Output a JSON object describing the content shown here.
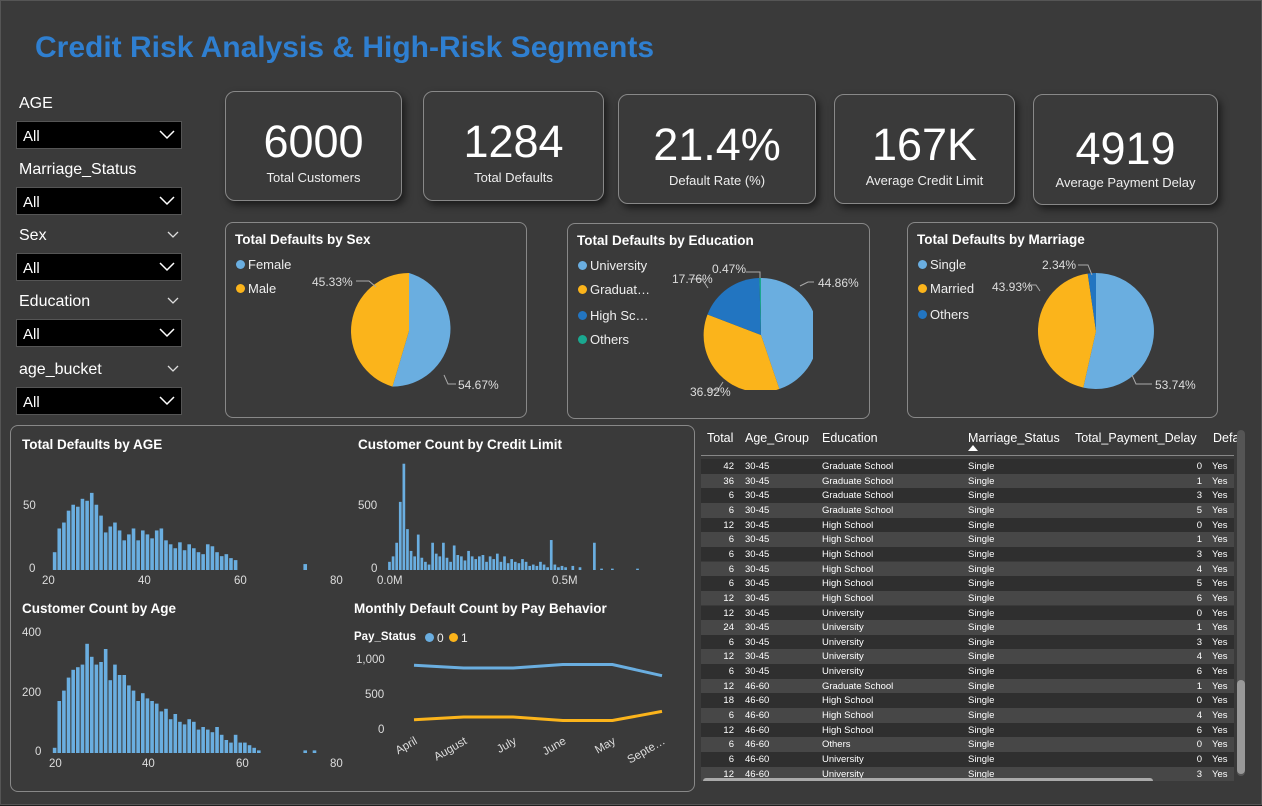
{
  "title": "Credit Risk Analysis & High-Risk Segments",
  "slicers": [
    {
      "label": "AGE",
      "value": "All"
    },
    {
      "label": "Marriage_Status",
      "value": "All"
    },
    {
      "label": "Sex",
      "value": "All"
    },
    {
      "label": "Education",
      "value": "All"
    },
    {
      "label": "age_bucket",
      "value": "All"
    }
  ],
  "kpis": [
    {
      "value": "6000",
      "label": "Total Customers"
    },
    {
      "value": "1284",
      "label": "Total Defaults"
    },
    {
      "value": "21.4%",
      "label": "Default Rate (%)"
    },
    {
      "value": "167K",
      "label": "Average Credit Limit"
    },
    {
      "value": "4919",
      "label": "Average Payment Delay"
    }
  ],
  "colors": {
    "blue": "#6aaee0",
    "yellow": "#fbb41b",
    "darkblue": "#2275c1",
    "teal": "#1aa890",
    "title": "#2f7fd0"
  },
  "pies": {
    "sex": {
      "title": "Total Defaults by Sex",
      "legend": [
        "Female",
        "Male"
      ],
      "labels": [
        "54.67%",
        "45.33%"
      ]
    },
    "education": {
      "title": "Total Defaults by Education",
      "legend": [
        "University",
        "Graduat…",
        "High Sc…",
        "Others"
      ],
      "labels": [
        "44.86%",
        "36.92%",
        "17.76%",
        "0.47%"
      ]
    },
    "marriage": {
      "title": "Total Defaults by Marriage",
      "legend": [
        "Single",
        "Married",
        "Others"
      ],
      "labels": [
        "53.74%",
        "43.93%",
        "2.34%"
      ]
    }
  },
  "charts": {
    "defaults_by_age": {
      "title": "Total Defaults by AGE",
      "yticks": [
        "50",
        "0"
      ],
      "xticks": [
        "20",
        "40",
        "60",
        "80"
      ]
    },
    "count_by_credit": {
      "title": "Customer Count by Credit Limit",
      "yticks": [
        "500",
        "0"
      ],
      "xticks": [
        "0.0M",
        "0.5M"
      ]
    },
    "count_by_age": {
      "title": "Customer Count by Age",
      "yticks": [
        "400",
        "200",
        "0"
      ],
      "xticks": [
        "20",
        "40",
        "60",
        "80"
      ]
    },
    "monthly": {
      "title": "Monthly Default Count by Pay Behavior",
      "legend_title": "Pay_Status",
      "series_names": [
        "0",
        "1"
      ],
      "yticks": [
        "1,000",
        "500",
        "0"
      ],
      "xticks": [
        "April",
        "August",
        "July",
        "June",
        "May",
        "Septe…"
      ]
    }
  },
  "chart_data": [
    {
      "type": "bar",
      "title": "Total Defaults by AGE",
      "x": [
        21,
        22,
        23,
        24,
        25,
        26,
        27,
        28,
        29,
        30,
        31,
        32,
        33,
        34,
        35,
        36,
        37,
        38,
        39,
        40,
        41,
        42,
        43,
        44,
        45,
        46,
        47,
        48,
        49,
        50,
        51,
        52,
        53,
        54,
        55,
        56,
        57,
        58,
        59,
        60,
        61,
        62,
        63,
        64,
        65,
        66,
        67,
        68,
        69,
        70,
        71,
        72,
        73,
        74,
        75,
        76,
        77,
        78,
        79
      ],
      "values": [
        18,
        42,
        48,
        60,
        66,
        64,
        72,
        70,
        78,
        66,
        55,
        38,
        44,
        48,
        40,
        30,
        36,
        42,
        30,
        40,
        36,
        32,
        40,
        42,
        30,
        26,
        22,
        28,
        20,
        26,
        22,
        18,
        16,
        26,
        24,
        18,
        14,
        16,
        12,
        10,
        0,
        0,
        0,
        0,
        0,
        0,
        0,
        0,
        0,
        0,
        0,
        0,
        0,
        0,
        6,
        0,
        0,
        0,
        0
      ],
      "ylim": [
        0,
        90
      ],
      "xlim": [
        18,
        82
      ]
    },
    {
      "type": "bar",
      "title": "Customer Count by Credit Limit",
      "x": [
        0.01,
        0.02,
        0.03,
        0.04,
        0.05,
        0.06,
        0.07,
        0.08,
        0.09,
        0.1,
        0.11,
        0.12,
        0.13,
        0.14,
        0.15,
        0.16,
        0.17,
        0.18,
        0.19,
        0.2,
        0.21,
        0.22,
        0.23,
        0.24,
        0.25,
        0.26,
        0.27,
        0.28,
        0.29,
        0.3,
        0.31,
        0.32,
        0.33,
        0.34,
        0.35,
        0.36,
        0.37,
        0.38,
        0.39,
        0.4,
        0.41,
        0.42,
        0.43,
        0.44,
        0.45,
        0.46,
        0.47,
        0.48,
        0.49,
        0.5,
        0.52,
        0.54,
        0.58,
        0.6,
        0.63,
        0.7
      ],
      "values": [
        60,
        100,
        200,
        500,
        780,
        300,
        140,
        100,
        260,
        90,
        60,
        40,
        200,
        120,
        100,
        200,
        90,
        60,
        180,
        110,
        100,
        70,
        140,
        100,
        80,
        100,
        110,
        60,
        100,
        80,
        120,
        60,
        100,
        50,
        80,
        60,
        50,
        80,
        60,
        30,
        40,
        30,
        60,
        40,
        20,
        220,
        40,
        20,
        30,
        20,
        30,
        20,
        200,
        10,
        10,
        10
      ],
      "ylim": [
        0,
        800
      ],
      "xlim": [
        -0.02,
        0.72
      ]
    },
    {
      "type": "bar",
      "title": "Customer Count by Age",
      "x": [
        21,
        22,
        23,
        24,
        25,
        26,
        27,
        28,
        29,
        30,
        31,
        32,
        33,
        34,
        35,
        36,
        37,
        38,
        39,
        40,
        41,
        42,
        43,
        44,
        45,
        46,
        47,
        48,
        49,
        50,
        51,
        52,
        53,
        54,
        55,
        56,
        57,
        58,
        59,
        60,
        61,
        62,
        63,
        64,
        65,
        66,
        67,
        68,
        69,
        70,
        71,
        72,
        73,
        74,
        75,
        76,
        77,
        78,
        79
      ],
      "values": [
        20,
        200,
        240,
        290,
        320,
        330,
        340,
        420,
        370,
        340,
        350,
        400,
        280,
        340,
        300,
        300,
        260,
        240,
        200,
        230,
        210,
        200,
        190,
        160,
        170,
        130,
        150,
        120,
        110,
        130,
        120,
        90,
        100,
        90,
        80,
        100,
        70,
        50,
        40,
        70,
        40,
        40,
        30,
        20,
        10,
        0,
        0,
        0,
        0,
        0,
        0,
        0,
        0,
        0,
        10,
        0,
        10,
        0,
        0
      ],
      "ylim": [
        0,
        450
      ],
      "xlim": [
        18,
        82
      ]
    },
    {
      "type": "line",
      "title": "Monthly Default Count by Pay Behavior",
      "categories": [
        "April",
        "August",
        "July",
        "June",
        "May",
        "Septe…"
      ],
      "series": [
        {
          "name": "0",
          "values": [
            940,
            900,
            900,
            950,
            950,
            790
          ]
        },
        {
          "name": "1",
          "values": [
            160,
            200,
            200,
            150,
            150,
            280
          ]
        }
      ],
      "ylim": [
        0,
        1000
      ],
      "ylabel": "",
      "xlabel": ""
    }
  ],
  "table": {
    "headers": [
      "Total",
      "Age_Group",
      "Education",
      "Marriage_Status",
      "Total_Payment_Delay",
      "Defa"
    ],
    "rows": [
      [
        "42",
        "30-45",
        "Graduate School",
        "Single",
        "0",
        "Yes"
      ],
      [
        "36",
        "30-45",
        "Graduate School",
        "Single",
        "1",
        "Yes"
      ],
      [
        "6",
        "30-45",
        "Graduate School",
        "Single",
        "3",
        "Yes"
      ],
      [
        "6",
        "30-45",
        "Graduate School",
        "Single",
        "5",
        "Yes"
      ],
      [
        "12",
        "30-45",
        "High School",
        "Single",
        "0",
        "Yes"
      ],
      [
        "6",
        "30-45",
        "High School",
        "Single",
        "1",
        "Yes"
      ],
      [
        "6",
        "30-45",
        "High School",
        "Single",
        "3",
        "Yes"
      ],
      [
        "6",
        "30-45",
        "High School",
        "Single",
        "4",
        "Yes"
      ],
      [
        "6",
        "30-45",
        "High School",
        "Single",
        "5",
        "Yes"
      ],
      [
        "12",
        "30-45",
        "High School",
        "Single",
        "6",
        "Yes"
      ],
      [
        "12",
        "30-45",
        "University",
        "Single",
        "0",
        "Yes"
      ],
      [
        "24",
        "30-45",
        "University",
        "Single",
        "1",
        "Yes"
      ],
      [
        "6",
        "30-45",
        "University",
        "Single",
        "3",
        "Yes"
      ],
      [
        "12",
        "30-45",
        "University",
        "Single",
        "4",
        "Yes"
      ],
      [
        "6",
        "30-45",
        "University",
        "Single",
        "6",
        "Yes"
      ],
      [
        "12",
        "46-60",
        "Graduate School",
        "Single",
        "1",
        "Yes"
      ],
      [
        "18",
        "46-60",
        "High School",
        "Single",
        "0",
        "Yes"
      ],
      [
        "6",
        "46-60",
        "High School",
        "Single",
        "4",
        "Yes"
      ],
      [
        "12",
        "46-60",
        "High School",
        "Single",
        "6",
        "Yes"
      ],
      [
        "6",
        "46-60",
        "Others",
        "Single",
        "0",
        "Yes"
      ],
      [
        "6",
        "46-60",
        "University",
        "Single",
        "0",
        "Yes"
      ],
      [
        "12",
        "46-60",
        "University",
        "Single",
        "3",
        "Yes"
      ]
    ]
  }
}
